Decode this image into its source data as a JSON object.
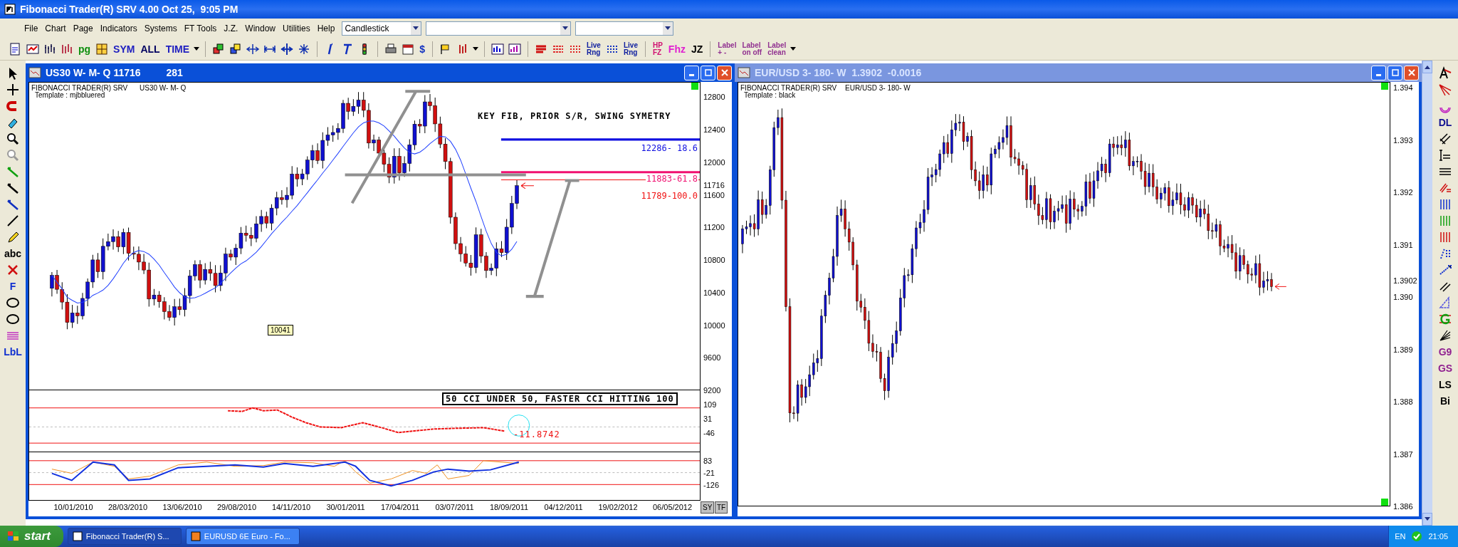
{
  "app": {
    "title": "Fibonacci Trader(R) SRV 4.00 Oct 25,  9:05 PM"
  },
  "menu": [
    "File",
    "Chart",
    "Page",
    "Indicators",
    "Systems",
    "FT Tools",
    "J.Z.",
    "Window",
    "Utilities",
    "Help"
  ],
  "chart_type": {
    "value": "Candlestick"
  },
  "toolbar": [
    {
      "kind": "icon"
    },
    {
      "kind": "icon"
    },
    {
      "kind": "icon"
    },
    {
      "kind": "icon"
    },
    {
      "kind": "text",
      "label": "pg",
      "color": "#109010"
    },
    {
      "kind": "icon"
    },
    {
      "kind": "text",
      "label": "SYM",
      "color": "#2020c0"
    },
    {
      "kind": "text",
      "label": "ALL",
      "color": "#000060"
    },
    {
      "kind": "text",
      "label": "TIME",
      "color": "#2020c0"
    },
    {
      "kind": "caret"
    },
    {
      "kind": "sep"
    },
    {
      "kind": "icon"
    },
    {
      "kind": "icon"
    },
    {
      "kind": "icon"
    },
    {
      "kind": "icon"
    },
    {
      "kind": "icon"
    },
    {
      "kind": "icon"
    },
    {
      "kind": "sep"
    },
    {
      "kind": "icon"
    },
    {
      "kind": "icon"
    },
    {
      "kind": "icon"
    },
    {
      "kind": "sep"
    },
    {
      "kind": "icon"
    },
    {
      "kind": "icon"
    },
    {
      "kind": "text",
      "label": "$",
      "color": "#1030c0"
    },
    {
      "kind": "sep"
    },
    {
      "kind": "icon"
    },
    {
      "kind": "icon"
    },
    {
      "kind": "caret"
    },
    {
      "kind": "sep"
    },
    {
      "kind": "icon"
    },
    {
      "kind": "icon"
    },
    {
      "kind": "sep"
    },
    {
      "kind": "icon"
    },
    {
      "kind": "icon"
    },
    {
      "kind": "icon"
    },
    {
      "kind": "text",
      "label": "Live",
      "sub": "Rng",
      "color": "#1020a0"
    },
    {
      "kind": "icon"
    },
    {
      "kind": "text",
      "label": "Live",
      "sub": "Rng",
      "color": "#1020a0"
    },
    {
      "kind": "sep"
    },
    {
      "kind": "text",
      "label": "HP",
      "sub": "FZ",
      "color": "#d01070"
    },
    {
      "kind": "text",
      "label": "Fhz",
      "color": "#e020d0"
    },
    {
      "kind": "text",
      "label": "JZ",
      "color": "#000000"
    },
    {
      "kind": "sep"
    },
    {
      "kind": "text",
      "label": "Label",
      "sub": "+ -",
      "color": "#903090"
    },
    {
      "kind": "text",
      "label": "Label",
      "sub": "on off",
      "color": "#903090"
    },
    {
      "kind": "text",
      "label": "Label",
      "sub": "clean",
      "color": "#903090"
    },
    {
      "kind": "caret"
    }
  ],
  "left_tools": [
    {
      "kind": "icon"
    },
    {
      "kind": "icon"
    },
    {
      "kind": "icon"
    },
    {
      "kind": "icon"
    },
    {
      "kind": "icon"
    },
    {
      "kind": "icon"
    },
    {
      "kind": "icon"
    },
    {
      "kind": "icon"
    },
    {
      "kind": "icon"
    },
    {
      "kind": "icon"
    },
    {
      "kind": "icon"
    },
    {
      "kind": "text",
      "label": "abc",
      "color": "#000000"
    },
    {
      "kind": "icon"
    },
    {
      "kind": "text",
      "label": "F",
      "color": "#1030d0"
    },
    {
      "kind": "icon"
    },
    {
      "kind": "icon"
    },
    {
      "kind": "icon"
    },
    {
      "kind": "text",
      "label": "LbL",
      "color": "#1030d0"
    }
  ],
  "right_tools": [
    {
      "kind": "icon"
    },
    {
      "kind": "icon"
    },
    {
      "kind": "icon"
    },
    {
      "kind": "text",
      "label": "DL",
      "color": "#101090"
    },
    {
      "kind": "icon"
    },
    {
      "kind": "icon"
    },
    {
      "kind": "icon"
    },
    {
      "kind": "icon"
    },
    {
      "kind": "icon"
    },
    {
      "kind": "icon"
    },
    {
      "kind": "icon"
    },
    {
      "kind": "icon"
    },
    {
      "kind": "icon"
    },
    {
      "kind": "icon"
    },
    {
      "kind": "icon"
    },
    {
      "kind": "icon"
    },
    {
      "kind": "icon"
    },
    {
      "kind": "text",
      "label": "G9",
      "color": "#902090"
    },
    {
      "kind": "text",
      "label": "GS",
      "color": "#902090"
    },
    {
      "kind": "text",
      "label": "LS",
      "color": "#000000"
    },
    {
      "kind": "text",
      "label": "Bi",
      "color": "#000000"
    }
  ],
  "left_chart": {
    "title": "US30 W- M- Q 11716",
    "count": "281",
    "brand": "FIBONACCI TRADER(R) SRV",
    "symbol": "US30 W- M- Q",
    "template": "Template : mjbbluered",
    "price_ticks": [
      "12800",
      "12400",
      "12000",
      "11600",
      "11200",
      "10800",
      "10400",
      "10000",
      "9600",
      "9200"
    ],
    "current_price": "11716",
    "headline": "KEY FIB, PRIOR S/R, SWING SYMETRY",
    "levels": [
      {
        "label": "12286- 18.6",
        "color": "#1010e0"
      },
      {
        "label": "11883-61.8",
        "color": "#f01070"
      },
      {
        "label": "11789-100.0",
        "color": "#f01010"
      }
    ],
    "marker": "10041",
    "cci_note": "50 CCI UNDER 50, FASTER CCI HITTING 100",
    "cci_value": "-11.8742",
    "cci_ticks": [
      "109",
      "31",
      "-46"
    ],
    "osc_ticks": [
      "83",
      "-21",
      "-126"
    ],
    "dates": [
      "10/01/2010",
      "28/03/2010",
      "13/06/2010",
      "29/08/2010",
      "14/11/2010",
      "30/01/2011",
      "17/04/2011",
      "03/07/2011",
      "18/09/2011",
      "04/12/2011",
      "19/02/2012",
      "06/05/2012"
    ],
    "corner_buttons": [
      "SY",
      "TF"
    ]
  },
  "right_chart": {
    "title": "EUR/USD 3- 180- W  1.3902  -0.0016",
    "brand": "FIBONACCI TRADER(R) SRV",
    "symbol": "EUR/USD 3- 180- W",
    "template": "Template : black",
    "price_ticks": [
      "1.394",
      "1.393",
      "1.392",
      "1.391",
      "1.390",
      "1.389",
      "1.388",
      "1.387",
      "1.386"
    ],
    "current_price": "1.3902"
  },
  "taskbar": {
    "start": "start",
    "tasks": [
      {
        "label": "Fibonacci Trader(R) S...",
        "selected": true
      },
      {
        "label": "EURUSD 6E Euro - Fo...",
        "selected": false
      }
    ],
    "language": "EN",
    "clock": "21:05"
  }
}
